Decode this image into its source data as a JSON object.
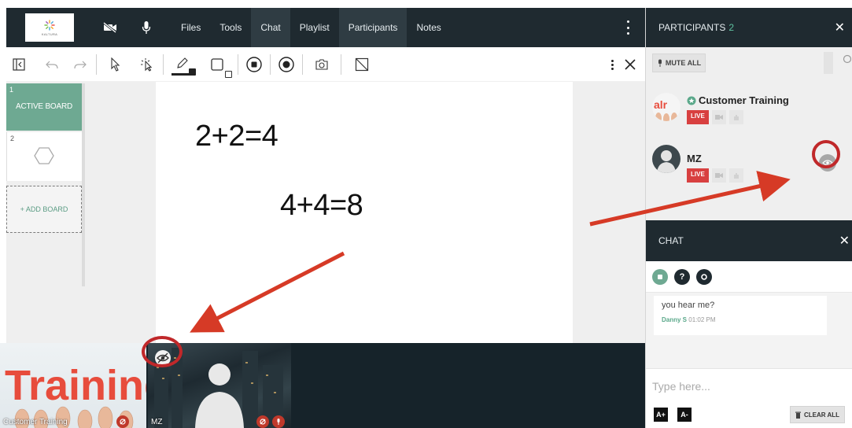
{
  "logo": {
    "text": "KALTURA"
  },
  "nav": {
    "items": [
      {
        "label": "Files",
        "active": false
      },
      {
        "label": "Tools",
        "active": false
      },
      {
        "label": "Chat",
        "active": true
      },
      {
        "label": "Playlist",
        "active": false
      },
      {
        "label": "Participants",
        "active": true
      },
      {
        "label": "Notes",
        "active": false
      }
    ]
  },
  "boards": {
    "items": [
      {
        "number": "1",
        "title": "ACTIVE BOARD"
      },
      {
        "number": "2",
        "title": ""
      }
    ],
    "add_label": "+ ADD BOARD"
  },
  "canvas": {
    "equations": [
      "2+2=4",
      "4+4=8"
    ]
  },
  "video": {
    "tiles": [
      {
        "label": "Customer Training",
        "art_text": "Training"
      },
      {
        "label": "MZ"
      }
    ]
  },
  "participants": {
    "title": "PARTICIPANTS",
    "count": "2",
    "mute_all": "MUTE ALL",
    "list": [
      {
        "name": "Customer Training",
        "avatar_text": "alr",
        "live": "LIVE"
      },
      {
        "name": "MZ",
        "live": "LIVE"
      }
    ]
  },
  "chat": {
    "title": "CHAT",
    "messages": [
      {
        "text": "you hear me?",
        "author": "Danny S",
        "time": "01:02 PM"
      }
    ],
    "placeholder": "Type here...",
    "font_up": "A+",
    "font_down": "A-",
    "clear_all": "CLEAR ALL"
  },
  "colors": {
    "nav_bg": "#1f2a30",
    "accent_green": "#6ea992",
    "live_red": "#d84040",
    "annotation_red": "#d63a26"
  }
}
